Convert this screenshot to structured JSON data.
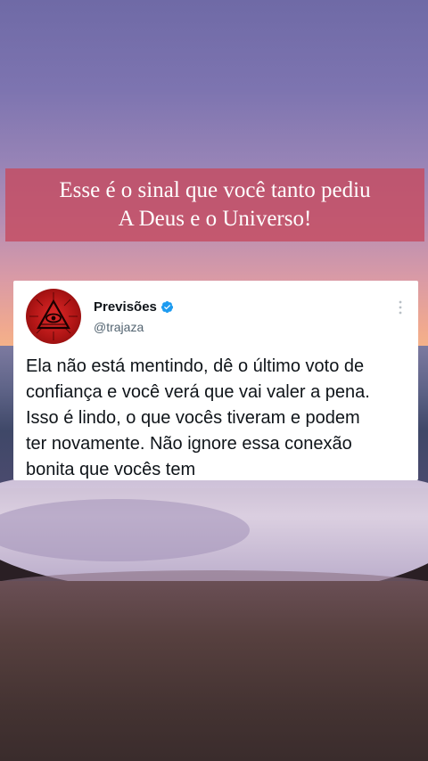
{
  "banner": {
    "line1": "Esse é o sinal que você tanto pediu",
    "line2": "A Deus e o Universo!",
    "color": "#c44c60"
  },
  "tweet": {
    "display_name": "Previsões",
    "handle": "@trajaza",
    "verified": true,
    "avatar_icon": "eye-of-providence-icon",
    "more_icon": "more-vertical-icon",
    "text_lines": [
      "Ela não está mentindo, dê o último voto de",
      "confiança e você verá que vai valer a pena.",
      "Isso é lindo, o que vocês tiveram e podem",
      "ter novamente. Não ignore essa conexão",
      "bonita que vocês tem"
    ],
    "verified_color": "#1d9bf0",
    "avatar_color": "#c41a1a"
  }
}
